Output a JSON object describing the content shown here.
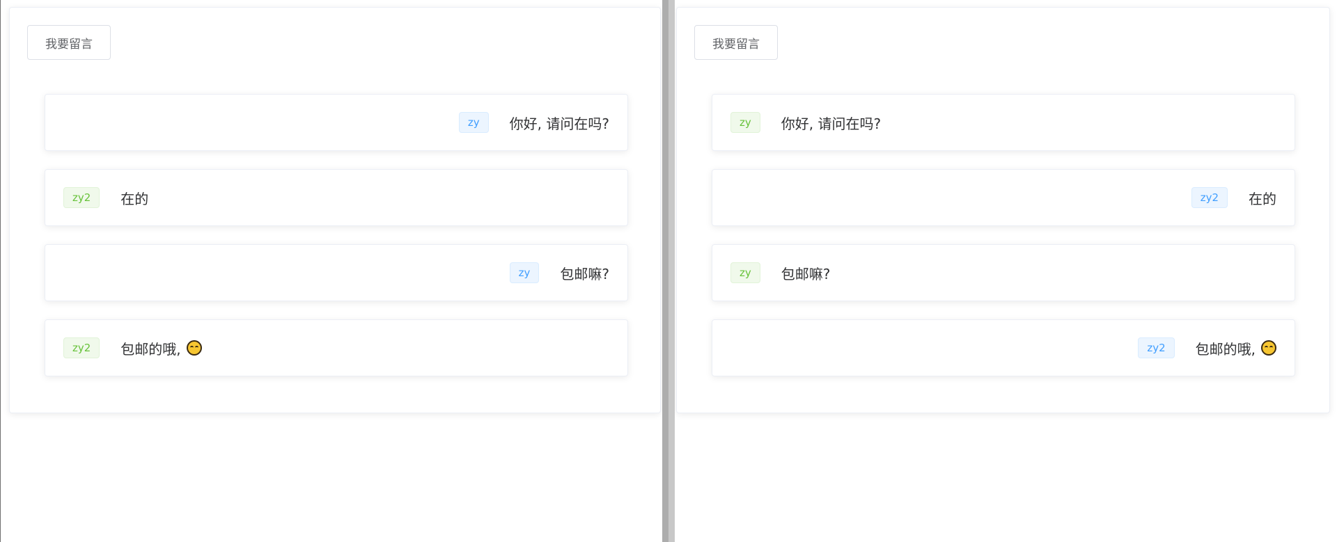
{
  "left_pane": {
    "button_label": "我要留言",
    "messages": [
      {
        "user": "zy",
        "text": "你好, 请问在吗?",
        "align": "right",
        "tag_color": "blue",
        "emoji": false
      },
      {
        "user": "zy2",
        "text": "在的",
        "align": "left",
        "tag_color": "green",
        "emoji": false
      },
      {
        "user": "zy",
        "text": "包邮嘛?",
        "align": "right",
        "tag_color": "blue",
        "emoji": false
      },
      {
        "user": "zy2",
        "text": "包邮的哦,",
        "align": "left",
        "tag_color": "green",
        "emoji": true
      }
    ]
  },
  "right_pane": {
    "button_label": "我要留言",
    "messages": [
      {
        "user": "zy",
        "text": "你好, 请问在吗?",
        "align": "left",
        "tag_color": "green",
        "emoji": false
      },
      {
        "user": "zy2",
        "text": "在的",
        "align": "right",
        "tag_color": "blue",
        "emoji": false
      },
      {
        "user": "zy",
        "text": "包邮嘛?",
        "align": "left",
        "tag_color": "green",
        "emoji": false
      },
      {
        "user": "zy2",
        "text": "包邮的哦,",
        "align": "right",
        "tag_color": "blue",
        "emoji": true
      }
    ]
  },
  "icons": {
    "emoji": "smiling-face-icon"
  },
  "colors": {
    "tag_blue_text": "#409eff",
    "tag_green_text": "#67c23a",
    "emoji_fill": "#f7c631"
  }
}
